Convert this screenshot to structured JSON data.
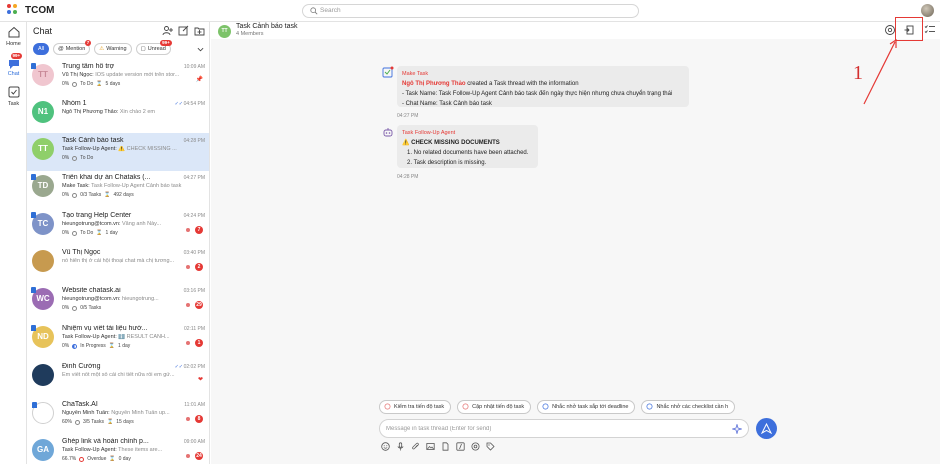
{
  "app": {
    "brand": "TCOM"
  },
  "search": {
    "placeholder": "Search"
  },
  "rail": {
    "home": {
      "label": "Home"
    },
    "chat": {
      "label": "Chat",
      "badge": "99+"
    },
    "task": {
      "label": "Task"
    }
  },
  "chat_panel": {
    "title": "Chat",
    "filters": [
      {
        "label": "All",
        "badge": ""
      },
      {
        "label": "Mention",
        "badge": "7"
      },
      {
        "label": "Warning",
        "badge": ""
      },
      {
        "label": "Unread",
        "badge": "99+"
      }
    ],
    "conversations": [
      {
        "initials": "TT",
        "color": "#f0c6cf",
        "text_color": "#c98a98",
        "name": "Trung tâm hỗ trợ",
        "time": "10:09 AM",
        "sender": "Vũ Thị Ngọc:",
        "preview": "IOS update version mới trên stor...",
        "progress": "0%",
        "status": "To Do",
        "due": "5 days",
        "unread": ""
      },
      {
        "initials": "N1",
        "color": "#4fc27e",
        "text_color": "#ffffff",
        "name": "Nhóm 1",
        "time": "04:54 PM",
        "sender": "Ngô Thị Phương Thảo:",
        "preview": "Xin chào 2 em",
        "progress": "",
        "status": "",
        "due": "",
        "unread": ""
      },
      {
        "initials": "TT",
        "color": "#8fcf6a",
        "text_color": "#ffffff",
        "name": "Task Cảnh báo task",
        "time": "04:28 PM",
        "sender": "Task Follow-Up Agent:",
        "preview": "⚠️ CHECK MISSING ...",
        "progress": "0%",
        "status": "To Do",
        "due": "",
        "unread": ""
      },
      {
        "initials": "TD",
        "color": "#9aa88f",
        "text_color": "#ffffff",
        "name": "Triển khai dự án Chataks (...",
        "time": "04:27 PM",
        "sender": "Make Task:",
        "preview": "Task Follow-Up Agent Cảnh báo task",
        "progress": "0%",
        "status": "0/3 Tasks",
        "due": "492 days",
        "unread": ""
      },
      {
        "initials": "TC",
        "color": "#7e93c8",
        "text_color": "#ffffff",
        "name": "Tạo trang Help Center",
        "time": "04:24 PM",
        "sender": "hieungotrung@tcom.vn:",
        "preview": "Vâng anh Này...",
        "progress": "0%",
        "status": "To Do",
        "due": "1 day",
        "unread": "7"
      },
      {
        "initials": "",
        "color": "#c79a4f",
        "text_color": "#ffffff",
        "name": "Vũ Thị Ngọc",
        "time": "03:40 PM",
        "sender": "",
        "preview": "nó hiển thị ở cái hội thoại chat mà chị tương...",
        "progress": "",
        "status": "",
        "due": "",
        "unread": "2"
      },
      {
        "initials": "WC",
        "color": "#9b6cb3",
        "text_color": "#ffffff",
        "name": "Website chatask.ai",
        "time": "03:16 PM",
        "sender": "hieungotrung@tcom.vn:",
        "preview": "hieungotrung...",
        "progress": "0%",
        "status": "0/5 Tasks",
        "due": "",
        "unread": "29"
      },
      {
        "initials": "ND",
        "color": "#e7c35a",
        "text_color": "#ffffff",
        "name": "Nhiệm vụ viết tài liệu hướ...",
        "time": "02:11 PM",
        "sender": "Task Follow-Up Agent:",
        "preview": "ℹ️ RESULT CẢNH...",
        "progress": "0%",
        "status": "In Progress",
        "due": "1 day",
        "unread": "1"
      },
      {
        "initials": "",
        "color": "#1f3b5c",
        "text_color": "#ffffff",
        "name": "Đinh Cường",
        "time": "02:02 PM",
        "sender": "",
        "preview": "Em viết nốt một số cái chi tiết nữa rồi em gử...",
        "progress": "",
        "status": "",
        "due": "",
        "unread": ""
      },
      {
        "initials": "",
        "color": "#ffffff",
        "text_color": "#3d6fdc",
        "name": "ChaTask.AI",
        "time": "11:01 AM",
        "sender": "Nguyễn Minh Tuấn:",
        "preview": "Nguyễn Minh Tuấn up...",
        "progress": "60%",
        "status": "3/5 Tasks",
        "due": "15 days",
        "unread": "8"
      },
      {
        "initials": "GA",
        "color": "#6fa7d8",
        "text_color": "#ffffff",
        "name": "Ghép link và hoàn chỉnh p...",
        "time": "09:00 AM",
        "sender": "Task Follow-Up Agent:",
        "preview": "These items are...",
        "progress": "66.7%",
        "status": "Overdue",
        "due": "0 day",
        "unread": "24"
      }
    ]
  },
  "conversation": {
    "avatar": "TT",
    "title": "Task Cảnh báo task",
    "subtitle": "4 Members",
    "messages": [
      {
        "sender": "Make Task",
        "actor": "Ngô Thị Phương Thảo",
        "line1": " created a Task thread with the information",
        "line2": "- Task Name: Task Follow-Up Agent Cảnh báo task đến ngày thực hiện nhưng chưa chuyển trạng thái",
        "line3": "- Chat Name: Task Cảnh báo task",
        "time": "04:27 PM"
      },
      {
        "sender": "Task Follow-Up Agent",
        "heading": "⚠️ CHECK MISSING DOCUMENTS",
        "item1": "1. No related documents have been attached.",
        "item2": "2. Task description is missing.",
        "time": "04:28 PM"
      }
    ]
  },
  "annotation": {
    "number": "1"
  },
  "suggestions": [
    "Kiểm tra tiến độ task",
    "Cập nhật tiến độ task",
    "Nhắc nhở task sắp tới deadline",
    "Nhắc nhở các checklist cần h"
  ],
  "composer": {
    "placeholder": "Message in task thread (Enter for send)"
  },
  "colors": {
    "accent": "#3d6fdc",
    "alert": "#e53935",
    "selected": "#dbe7f8"
  }
}
